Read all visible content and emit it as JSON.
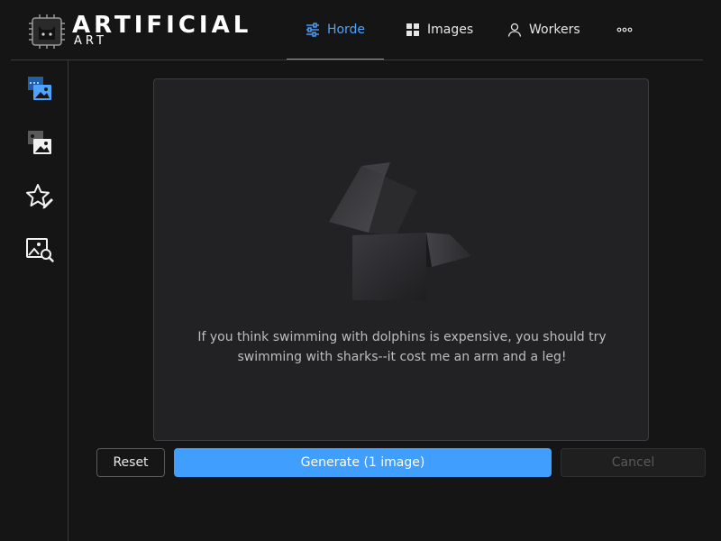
{
  "app": {
    "title": "ARTIFICIAL",
    "subtitle": "ART"
  },
  "nav": {
    "tabs": [
      {
        "label": "Horde",
        "icon": "sliders-icon",
        "active": true
      },
      {
        "label": "Images",
        "icon": "grid-icon",
        "active": false
      },
      {
        "label": "Workers",
        "icon": "user-icon",
        "active": false
      }
    ],
    "more_icon": "more-dots-icon"
  },
  "sidebar": {
    "items": [
      {
        "icon": "image-generation-icon",
        "active": true
      },
      {
        "icon": "image-to-image-icon",
        "active": false
      },
      {
        "icon": "star-edit-icon",
        "active": false
      },
      {
        "icon": "image-search-icon",
        "active": false
      }
    ]
  },
  "preview": {
    "message": "If you think swimming with dolphins is expensive, you should try swimming with sharks--it cost me an arm and a leg!"
  },
  "actions": {
    "reset_label": "Reset",
    "generate_label": "Generate (1 image)",
    "cancel_label": "Cancel"
  },
  "colors": {
    "accent": "#409eff",
    "background": "#151515",
    "panel": "#222225"
  }
}
